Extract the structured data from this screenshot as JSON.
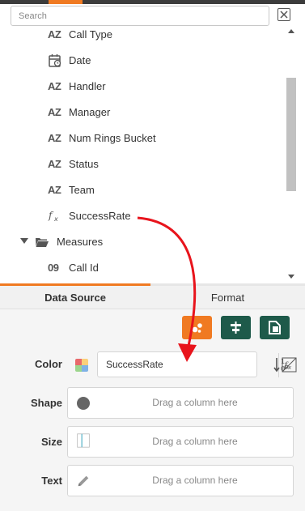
{
  "search": {
    "placeholder": "Search"
  },
  "tree": [
    {
      "icon": "AZ",
      "icon_name": "text-type-icon",
      "label": "Call Type"
    },
    {
      "icon": "",
      "icon_name": "date-type-icon",
      "label": "Date"
    },
    {
      "icon": "AZ",
      "icon_name": "text-type-icon",
      "label": "Handler"
    },
    {
      "icon": "AZ",
      "icon_name": "text-type-icon",
      "label": "Manager"
    },
    {
      "icon": "AZ",
      "icon_name": "text-type-icon",
      "label": "Num Rings Bucket"
    },
    {
      "icon": "AZ",
      "icon_name": "text-type-icon",
      "label": "Status"
    },
    {
      "icon": "AZ",
      "icon_name": "text-type-icon",
      "label": "Team"
    },
    {
      "icon": "",
      "icon_name": "calculated-field-icon",
      "label": "SuccessRate"
    },
    {
      "icon": "",
      "icon_name": "folder-open-icon",
      "label": "Measures"
    },
    {
      "icon": "09",
      "icon_name": "number-type-icon",
      "label": "Call Id"
    }
  ],
  "tabs": {
    "data_source": "Data Source",
    "format": "Format"
  },
  "toolbar": {
    "btn1_color": "#f07a22",
    "btn2_color": "#1e5a4a",
    "btn3_color": "#1e5a4a"
  },
  "mappings": {
    "color_label": "Color",
    "color_value": "SuccessRate",
    "shape_label": "Shape",
    "shape_placeholder": "Drag a column here",
    "size_label": "Size",
    "size_placeholder": "Drag a column here",
    "text_label": "Text",
    "text_placeholder": "Drag a column here"
  },
  "accent_color": "#f07a22",
  "annotation_arrow_color": "#e8141c"
}
